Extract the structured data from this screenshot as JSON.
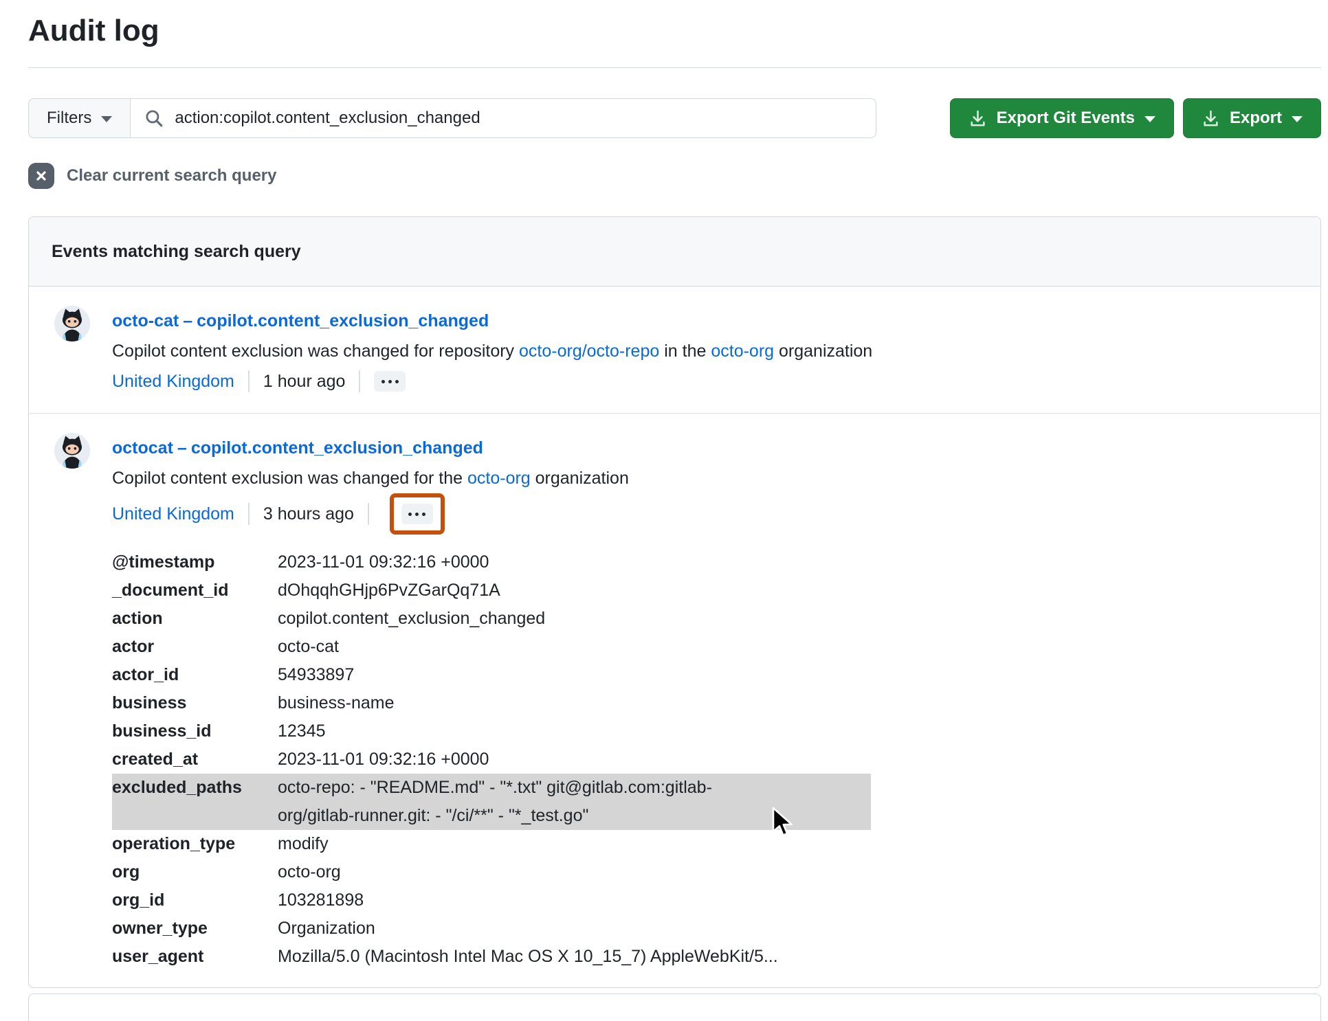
{
  "page": {
    "title": "Audit log"
  },
  "toolbar": {
    "filters_label": "Filters",
    "search_value": "action:copilot.content_exclusion_changed",
    "export_git_events_label": "Export Git Events",
    "export_label": "Export"
  },
  "clear_query": {
    "label": "Clear current search query"
  },
  "results": {
    "header": "Events matching search query",
    "events": [
      {
        "actor": "octo-cat",
        "separator": "–",
        "action": "copilot.content_exclusion_changed",
        "description": {
          "pre": "Copilot content exclusion was changed for repository ",
          "repo_link": "octo-org/octo-repo",
          "mid": " in the ",
          "org_link": "octo-org",
          "post": " organization"
        },
        "location": "United Kingdom",
        "time": "1 hour ago",
        "more_label": "kebab-menu"
      },
      {
        "actor": "octocat",
        "separator": "–",
        "action": "copilot.content_exclusion_changed",
        "description": {
          "pre": "Copilot content exclusion was changed for the ",
          "org_link": "octo-org",
          "post": " organization"
        },
        "location": "United Kingdom",
        "time": "3 hours ago",
        "more_label": "kebab-menu",
        "details": {
          "rows": [
            {
              "key": "@timestamp",
              "value": "2023-11-01 09:32:16 +0000"
            },
            {
              "key": "_document_id",
              "value": "dOhqqhGHjp6PvZGarQq71A"
            },
            {
              "key": "action",
              "value": "copilot.content_exclusion_changed"
            },
            {
              "key": "actor",
              "value": "octo-cat"
            },
            {
              "key": "actor_id",
              "value": "54933897"
            },
            {
              "key": "business",
              "value": "business-name"
            },
            {
              "key": "business_id",
              "value": "12345"
            },
            {
              "key": "created_at",
              "value": "2023-11-01 09:32:16 +0000"
            },
            {
              "key": "excluded_paths",
              "value_lines": [
                "octo-repo: - \"README.md\" - \"*.txt\" git@gitlab.com:gitlab-",
                "org/gitlab-runner.git: - \"/ci/**\" - \"*_test.go\""
              ],
              "highlighted": true
            },
            {
              "key": "operation_type",
              "value": "modify"
            },
            {
              "key": "org",
              "value": "octo-org"
            },
            {
              "key": "org_id",
              "value": "103281898"
            },
            {
              "key": "owner_type",
              "value": "Organization"
            },
            {
              "key": "user_agent",
              "value": "Mozilla/5.0 (Macintosh Intel Mac OS X 10_15_7) AppleWebKit/5..."
            }
          ]
        }
      }
    ]
  },
  "colors": {
    "accent_green": "#1f883d",
    "link_blue": "#0969da",
    "highlight_orange": "#c4500c",
    "row_highlight_gray": "#d5d5d5",
    "muted_gray": "#57606a"
  }
}
